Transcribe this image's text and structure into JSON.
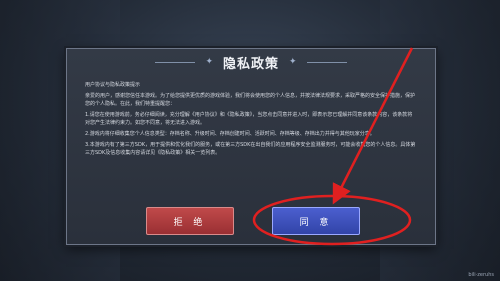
{
  "dialog": {
    "title": "隐私政策",
    "subtitle": "用户协议与隐私政策提示",
    "paragraphs": [
      "亲爱的用户，感谢您信任本游戏。为了给您提供更优质的游戏体验，我们将会使用您的个人信息，并按法律法规要求，采取严格的安全保护措施，保护您的个人隐私。在此，我们特重提醒您：",
      "1.请您在使用游戏前，务必仔细阅读，充分理解《用户协议》和《隐私政策》，当您点击同意并进入时，即表示您已理解并同意该条款内容，该条款将对您产生法律约束力。如您不同意，将无法进入游戏。",
      "2.游戏内将仔细收集您个人信息类型：存档名称、升级时间、存档创建时间、活跃时间、存档等级、存档出力并得与其他玩家分享。",
      "3.本游戏内有了第三方SDK，用于提供和优化我们的服务，或在第三方SDK在出自我们的应用程序安全监测服务时，可能会收集您的个人信息。具体第三方SDK及信息收集内容请详见《隐私政策》相关一览列表。"
    ],
    "reject_label": "拒 绝",
    "agree_label": "同 意"
  },
  "watermark": "bili·zeruhs",
  "colors": {
    "reject": "#b03c3f",
    "agree": "#3f52bf",
    "annotation": "#e02020"
  }
}
